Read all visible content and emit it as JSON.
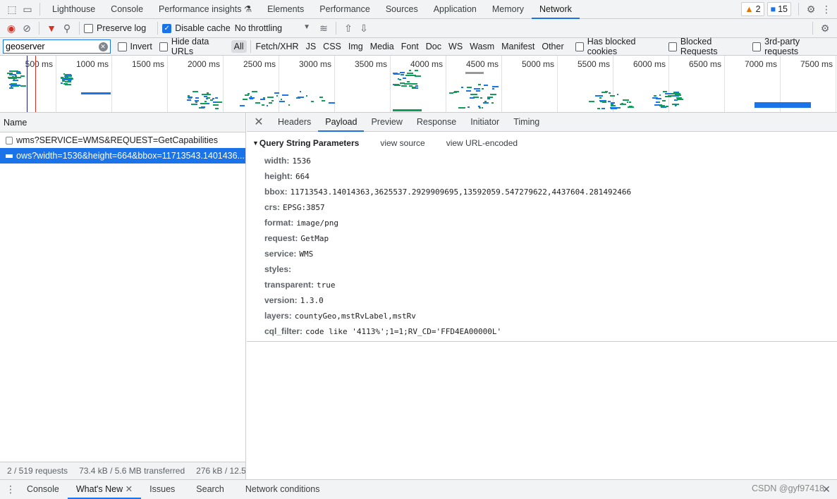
{
  "tabs": [
    "Lighthouse",
    "Console",
    "Performance insights",
    "Elements",
    "Performance",
    "Sources",
    "Application",
    "Memory",
    "Network"
  ],
  "active_tab": "Network",
  "badges": {
    "warnings": "2",
    "messages": "15"
  },
  "toolbar": {
    "preserve_log": "Preserve log",
    "disable_cache": "Disable cache",
    "throttling": "No throttling"
  },
  "filter": {
    "value": "geoserver",
    "invert": "Invert",
    "hide_data_urls": "Hide data URLs",
    "types": [
      "All",
      "Fetch/XHR",
      "JS",
      "CSS",
      "Img",
      "Media",
      "Font",
      "Doc",
      "WS",
      "Wasm",
      "Manifest",
      "Other"
    ],
    "has_blocked_cookies": "Has blocked cookies",
    "blocked_requests": "Blocked Requests",
    "third_party": "3rd-party requests"
  },
  "overview": {
    "ticks": [
      "500 ms",
      "1000 ms",
      "1500 ms",
      "2000 ms",
      "2500 ms",
      "3000 ms",
      "3500 ms",
      "4000 ms",
      "4500 ms",
      "5000 ms",
      "5500 ms",
      "6000 ms",
      "6500 ms",
      "7000 ms",
      "7500 ms"
    ]
  },
  "list": {
    "header": "Name",
    "rows": [
      "wms?SERVICE=WMS&REQUEST=GetCapabilities",
      "ows?width=1536&height=664&bbox=11713543.1401436..."
    ]
  },
  "status": {
    "requests": "2 / 519 requests",
    "transferred": "73.4 kB / 5.6 MB transferred",
    "resources": "276 kB / 12.5"
  },
  "detail": {
    "tabs": [
      "Headers",
      "Payload",
      "Preview",
      "Response",
      "Initiator",
      "Timing"
    ],
    "active": "Payload",
    "section": "Query String Parameters",
    "view_source": "view source",
    "view_encoded": "view URL-encoded",
    "params": [
      {
        "k": "width:",
        "v": "1536"
      },
      {
        "k": "height:",
        "v": "664"
      },
      {
        "k": "bbox:",
        "v": "11713543.14014363,3625537.2929909695,13592059.547279622,4437604.281492466"
      },
      {
        "k": "crs:",
        "v": "EPSG:3857"
      },
      {
        "k": "format:",
        "v": "image/png"
      },
      {
        "k": "request:",
        "v": "GetMap"
      },
      {
        "k": "service:",
        "v": "WMS"
      },
      {
        "k": "styles:",
        "v": ""
      },
      {
        "k": "transparent:",
        "v": "true"
      },
      {
        "k": "version:",
        "v": "1.3.0"
      },
      {
        "k": "layers:",
        "v": "countyGeo,mstRvLabel,mstRv"
      },
      {
        "k": "cql_filter:",
        "v": "code like '4113%';1=1;RV_CD='FFD4EA00000L'"
      }
    ]
  },
  "drawer": {
    "tabs": [
      "Console",
      "What's New",
      "Issues",
      "Search",
      "Network conditions"
    ],
    "active": "What's New"
  },
  "watermark": "CSDN @gyf97418"
}
